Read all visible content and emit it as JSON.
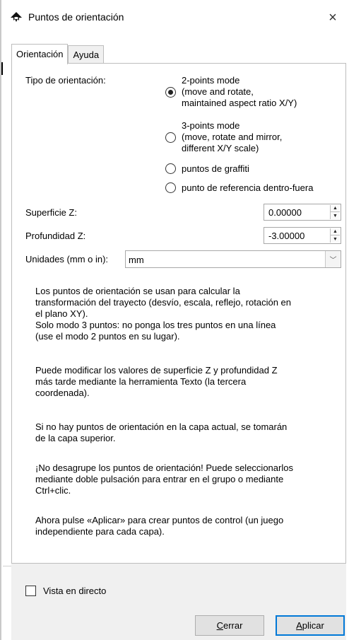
{
  "window": {
    "title": "Puntos de orientación",
    "close_glyph": "×"
  },
  "tabs": [
    {
      "label": "Orientación",
      "active": true
    },
    {
      "label": "Ayuda",
      "active": false
    }
  ],
  "orientation": {
    "label": "Tipo de orientación:",
    "options": [
      {
        "lines": [
          "2-points mode",
          "(move and rotate,",
          "maintained aspect ratio X/Y)"
        ],
        "checked": true
      },
      {
        "lines": [
          "3-points mode",
          "(move, rotate and mirror,",
          "different X/Y scale)"
        ],
        "checked": false
      },
      {
        "lines": [
          "puntos de graffiti"
        ],
        "checked": false
      },
      {
        "lines": [
          "punto de referencia dentro-fuera"
        ],
        "checked": false
      }
    ]
  },
  "surface_z": {
    "label": "Superficie Z:",
    "value": "0.00000"
  },
  "depth_z": {
    "label": "Profundidad Z:",
    "value": "-3.00000"
  },
  "units": {
    "label": "Unidades (mm o in):",
    "value": "mm"
  },
  "description": [
    [
      "Los puntos de orientación se usan para calcular la",
      "transformación del trayecto (desvío, escala, reflejo, rotación en",
      "el plano XY).",
      "Solo modo 3 puntos: no ponga los tres puntos en una línea",
      "(use el modo 2 puntos en su lugar)."
    ],
    [
      "Puede modificar los valores de superficie Z y profundidad Z",
      "más tarde mediante la herramienta Texto (la tercera",
      "coordenada)."
    ],
    [
      "Si no hay puntos de orientación en la capa actual, se tomarán",
      "de la capa superior."
    ],
    [
      "¡No desagrupe los puntos de orientación! Puede seleccionarlos",
      "mediante doble pulsación para entrar en el grupo o mediante",
      "Ctrl+clic."
    ],
    [
      "Ahora pulse «Aplicar» para crear puntos de control (un juego",
      "independiente para cada capa)."
    ]
  ],
  "live_preview": {
    "label": "Vista en directo",
    "checked": false
  },
  "buttons": {
    "close_first": "C",
    "close_rest": "errar",
    "apply_first": "A",
    "apply_rest": "plicar"
  },
  "icons": {
    "app": "inkscape-icon",
    "spin_up": "▲",
    "spin_down": "▼",
    "dropdown": "﹀"
  }
}
